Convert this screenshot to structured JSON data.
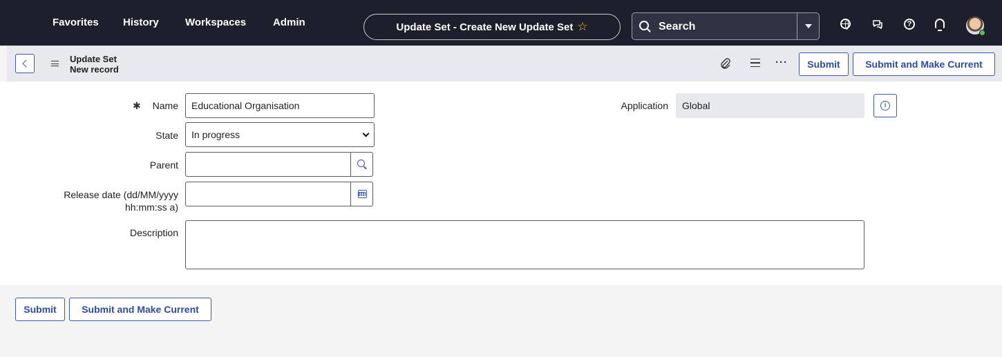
{
  "nav": {
    "items": [
      "Favorites",
      "History",
      "Workspaces",
      "Admin"
    ],
    "context_title": "Update Set - Create New Update Set",
    "star_glyph": "☆",
    "search_label": "Search",
    "icons": [
      "globe-icon",
      "chat-icon",
      "help-icon",
      "bell-icon",
      "avatar"
    ]
  },
  "header": {
    "table_name": "Update Set",
    "record_state": "New record",
    "submit_label": "Submit",
    "submit_current_label": "Submit and Make Current"
  },
  "form": {
    "name_label": "Name",
    "name_value": "Educational Organisation",
    "state_label": "State",
    "state_value": "In progress",
    "parent_label": "Parent",
    "parent_value": "",
    "release_label": "Release date (dd/MM/yyyy hh:mm:ss a)",
    "release_value": "",
    "description_label": "Description",
    "description_value": "",
    "application_label": "Application",
    "application_value": "Global"
  },
  "footer": {
    "submit_label": "Submit",
    "submit_current_label": "Submit and Make Current"
  },
  "colors": {
    "nav_bg": "#1d1f2c",
    "accent": "#3c57b5",
    "page_bg": "#f4f4f5"
  }
}
